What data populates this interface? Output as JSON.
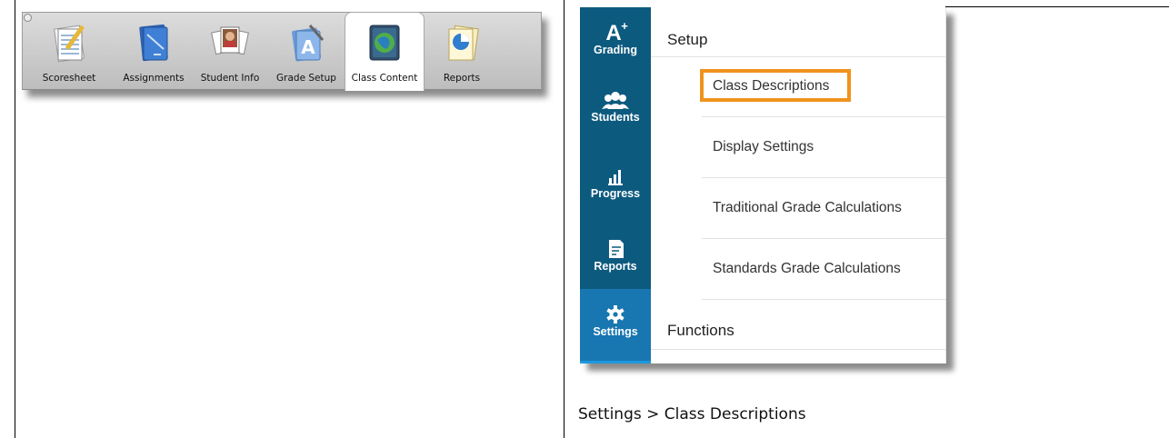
{
  "mac_toolbar": {
    "buttons": [
      {
        "label": "Scoresheet",
        "icon": "scoresheet-icon"
      },
      {
        "label": "Assignments",
        "icon": "assignments-icon"
      },
      {
        "label": "Student Info",
        "icon": "student-info-icon"
      },
      {
        "label": "Grade Setup",
        "icon": "grade-setup-icon"
      },
      {
        "label": "Class Content",
        "icon": "class-content-icon",
        "active": true
      },
      {
        "label": "Reports",
        "icon": "reports-icon"
      }
    ]
  },
  "web_app": {
    "nav": [
      {
        "label": "Grading",
        "icon": "a-plus-icon"
      },
      {
        "label": "Students",
        "icon": "students-icon"
      },
      {
        "label": "Progress",
        "icon": "progress-chart-icon"
      },
      {
        "label": "Reports",
        "icon": "reports-doc-icon"
      },
      {
        "label": "Settings",
        "icon": "gear-icon",
        "active": true
      }
    ],
    "setup_title": "Setup",
    "setup_items": [
      {
        "label": "Class Descriptions",
        "highlighted": true
      },
      {
        "label": "Display Settings"
      },
      {
        "label": "Traditional Grade Calculations"
      },
      {
        "label": "Standards Grade Calculations"
      }
    ],
    "functions_title": "Functions",
    "accent_color": "#f0931d",
    "nav_color": "#0d5a7f"
  },
  "caption": "Settings > Class Descriptions"
}
